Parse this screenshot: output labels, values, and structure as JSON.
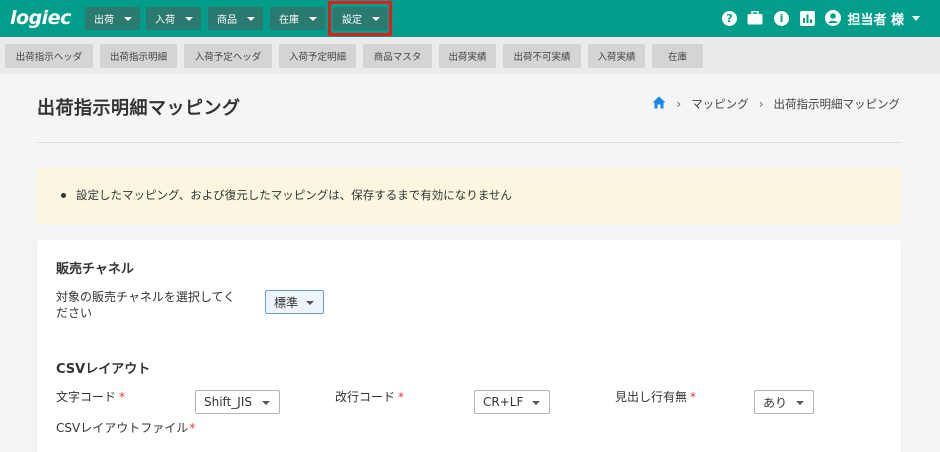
{
  "header": {
    "logo": "logiec",
    "nav": [
      {
        "label": "出荷"
      },
      {
        "label": "入荷"
      },
      {
        "label": "商品"
      },
      {
        "label": "在庫"
      },
      {
        "label": "設定"
      }
    ],
    "user_name": "担当者 様",
    "icons": [
      "help-icon",
      "briefcase-icon",
      "info-icon",
      "chart-icon",
      "user-account-icon"
    ]
  },
  "tabs": [
    {
      "label": "出荷指示ヘッダ"
    },
    {
      "label": "出荷指示明細"
    },
    {
      "label": "入荷予定ヘッダ"
    },
    {
      "label": "入荷予定明細"
    },
    {
      "label": "商品マスタ"
    },
    {
      "label": "出荷実績"
    },
    {
      "label": "出荷不可実績"
    },
    {
      "label": "入荷実績"
    },
    {
      "label": "在庫"
    }
  ],
  "page": {
    "title": "出荷指示明細マッピング",
    "breadcrumb": [
      "マッピング",
      "出荷指示明細マッピング"
    ]
  },
  "notice": {
    "text": "設定したマッピング、および復元したマッピングは、保存するまで有効になりません"
  },
  "sales_channel": {
    "title": "販売チャネル",
    "label_line1": "対象の販売チャネルを選択してく",
    "label_line2": "ださい",
    "value": "標準"
  },
  "csv_layout": {
    "title": "CSVレイアウト",
    "charset_label": "文字コード",
    "charset_value": "Shift_JIS",
    "newline_label": "改行コード",
    "newline_value": "CR+LF",
    "header_label": "見出し行有無",
    "header_value": "あり",
    "file_label": "CSVレイアウトファイル",
    "required_mark": "*"
  },
  "colors": {
    "brand": "#009d8a",
    "highlight": "#e31b1b",
    "notice_bg": "#fbf6df",
    "required": "#e53935"
  }
}
